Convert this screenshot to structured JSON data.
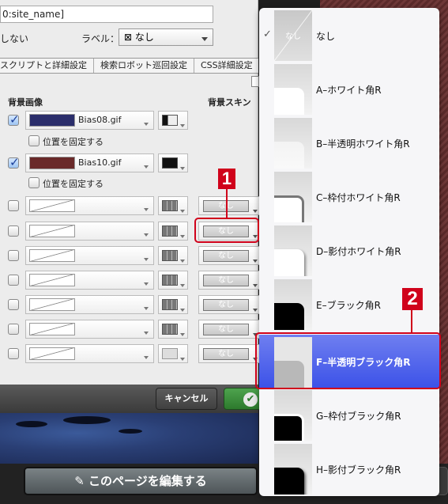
{
  "form": {
    "title_value": "0:site_name]",
    "option_text": "しない",
    "label_caption": "ラベル：",
    "label_select": "⊠ なし"
  },
  "tabs": [
    "スクリプトと詳細設定",
    "検索ロボット巡回設定",
    "CSS詳細設定"
  ],
  "table": {
    "col_image": "背景画像",
    "col_skin": "背景スキン",
    "fix_position_label": "位置を固定する",
    "rows": [
      {
        "checked": true,
        "image": "Bias08.gif",
        "swatch": "#2b2e6b",
        "fix": true
      },
      {
        "checked": true,
        "image": "Bias10.gif",
        "swatch": "#6a2a2a",
        "fix": true
      },
      {
        "checked": false,
        "image": "",
        "skin": "なし"
      },
      {
        "checked": false,
        "image": "",
        "skin": "なし"
      },
      {
        "checked": false,
        "image": "",
        "skin": "なし"
      },
      {
        "checked": false,
        "image": "",
        "skin": "なし"
      },
      {
        "checked": false,
        "image": "",
        "skin": "なし"
      },
      {
        "checked": false,
        "image": "",
        "skin": "なし"
      },
      {
        "checked": false,
        "image": "",
        "skin": "なし"
      }
    ]
  },
  "buttons": {
    "cancel": "キャンセル",
    "edit_page": "このページを編集する"
  },
  "menu": {
    "items": [
      {
        "label": "なし",
        "checked": true,
        "thumb_text": "なし"
      },
      {
        "label": "A–ホワイト角R"
      },
      {
        "label": "B–半透明ホワイト角R"
      },
      {
        "label": "C–枠付ホワイト角R"
      },
      {
        "label": "D–影付ホワイト角R"
      },
      {
        "label": "E–ブラック角R"
      },
      {
        "label": "F–半透明ブラック角R",
        "selected": true
      },
      {
        "label": "G–枠付ブラック角R"
      },
      {
        "label": "H–影付ブラック角R"
      }
    ]
  },
  "callouts": {
    "one": "1",
    "two": "2"
  },
  "icons": {
    "check": "✓",
    "checkmark_ok": "✔"
  }
}
